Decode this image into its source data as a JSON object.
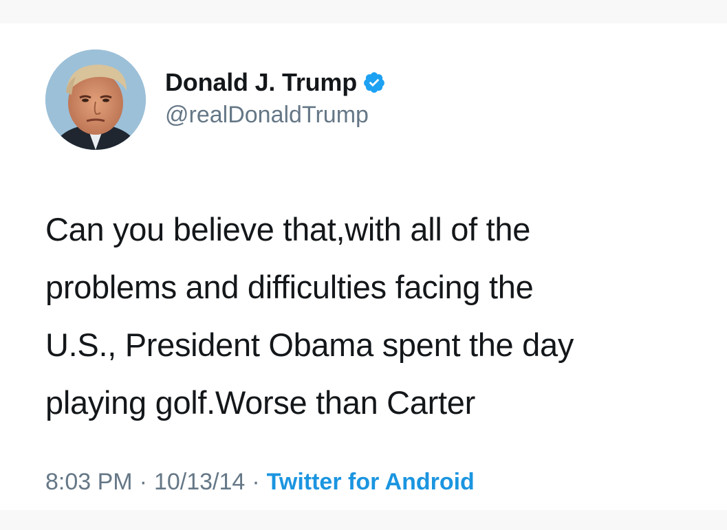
{
  "tweet": {
    "author": {
      "display_name": "Donald J. Trump",
      "handle": "@realDonaldTrump",
      "avatar_icon": "profile-photo",
      "verified_icon": "verified-badge-icon",
      "verified_color": "#1da1f2"
    },
    "text_lines": [
      "Can you believe that,with all of the",
      "problems and difficulties facing the",
      "U.S., President Obama spent the day",
      "playing golf.Worse than Carter"
    ],
    "meta": {
      "time": "8:03 PM",
      "separator": "·",
      "date": "10/13/14",
      "source": "Twitter for Android",
      "source_color": "#1b95e0"
    }
  }
}
